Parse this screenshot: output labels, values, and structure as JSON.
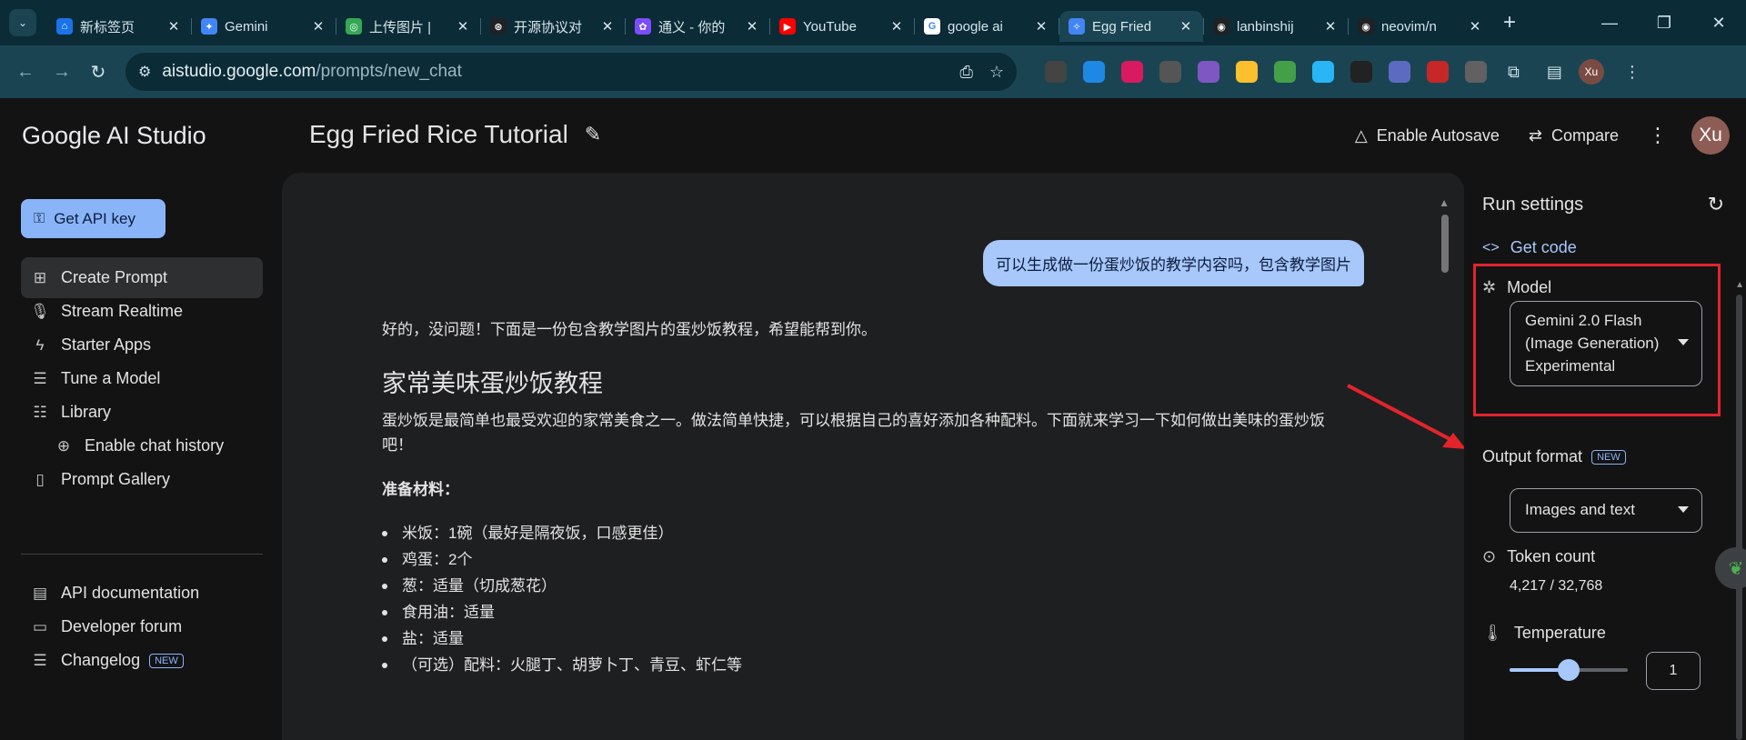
{
  "browser": {
    "tabs": [
      {
        "title": "新标签页",
        "color": "#1a73e8",
        "glyph": "⌂"
      },
      {
        "title": "Gemini",
        "color": "#4285f4",
        "glyph": "✦"
      },
      {
        "title": "上传图片 |",
        "color": "#34a853",
        "glyph": "◎"
      },
      {
        "title": "开源协议对",
        "color": "#202124",
        "glyph": "⊛"
      },
      {
        "title": "通义 - 你的",
        "color": "#7c4dff",
        "glyph": "✿"
      },
      {
        "title": "YouTube",
        "color": "#ff0000",
        "glyph": "▶"
      },
      {
        "title": "google ai",
        "color": "#ffffff",
        "glyph": "G"
      },
      {
        "title": "Egg Fried",
        "color": "#4285f4",
        "glyph": "✧"
      },
      {
        "title": "lanbinshij",
        "color": "#202124",
        "glyph": "◉"
      },
      {
        "title": "neovim/n",
        "color": "#202124",
        "glyph": "◉"
      }
    ],
    "active_tab": 7,
    "url_host": "aistudio.google.com",
    "url_path": "/prompts/new_chat",
    "profile_initials": "Xu",
    "extensions": [
      {
        "name": "owl-ext-icon",
        "color": "#444"
      },
      {
        "name": "globe-ext-icon",
        "color": "#1e88e5"
      },
      {
        "name": "translate-ext-icon",
        "color": "#d81b60"
      },
      {
        "name": "lens-ext-icon",
        "color": "#555"
      },
      {
        "name": "shield-ext-icon",
        "color": "#7e57c2"
      },
      {
        "name": "check-ext-icon",
        "color": "#fbc02d"
      },
      {
        "name": "leaf-ext-icon",
        "color": "#43a047"
      },
      {
        "name": "pen-ext-icon",
        "color": "#29b6f6"
      },
      {
        "name": "bili-ext-icon",
        "color": "#222"
      },
      {
        "name": "gem-ext-icon",
        "color": "#5c6bc0"
      },
      {
        "name": "target-ext-icon",
        "color": "#c62828"
      },
      {
        "name": "crx-ext-icon",
        "color": "#616161"
      }
    ]
  },
  "app": {
    "logo": "Google AI Studio",
    "api_key_label": "Get API key",
    "nav": [
      {
        "label": "Create Prompt",
        "icon": "create-prompt-icon",
        "glyph": "⊞",
        "active": true
      },
      {
        "label": "Stream Realtime",
        "icon": "mic-icon",
        "glyph": "🎙"
      },
      {
        "label": "Starter Apps",
        "icon": "bolt-icon",
        "glyph": "ϟ"
      },
      {
        "label": "Tune a Model",
        "icon": "tune-icon",
        "glyph": "☰"
      },
      {
        "label": "Library",
        "icon": "library-icon",
        "glyph": "☷"
      },
      {
        "label": "Enable chat history",
        "icon": "add-drive-icon",
        "glyph": "⊕",
        "indent": true
      },
      {
        "label": "Prompt Gallery",
        "icon": "gallery-icon",
        "glyph": "▯"
      }
    ],
    "nav2": [
      {
        "label": "API documentation",
        "icon": "docs-icon",
        "glyph": "▤"
      },
      {
        "label": "Developer forum",
        "icon": "forum-icon",
        "glyph": "▭"
      },
      {
        "label": "Changelog",
        "icon": "changelog-icon",
        "glyph": "☰",
        "badge": "NEW"
      }
    ],
    "title": "Egg Fried Rice Tutorial",
    "enable_autosave": "Enable Autosave",
    "compare": "Compare",
    "avatar": "Xu"
  },
  "chat": {
    "user_message": "可以生成做一份蛋炒饭的教学内容吗，包含教学图片",
    "reply_intro": "好的，没问题！下面是一份包含教学图片的蛋炒饭教程，希望能帮到你。",
    "reply_heading": "家常美味蛋炒饭教程",
    "reply_paragraph": "蛋炒饭是最简单也最受欢迎的家常美食之一。做法简单快捷，可以根据自己的喜好添加各种配料。下面就来学习一下如何做出美味的蛋炒饭吧！",
    "ingredients_title": "准备材料：",
    "ingredients": [
      "米饭：1碗（最好是隔夜饭，口感更佳）",
      "鸡蛋：2个",
      "葱：适量（切成葱花）",
      "食用油：适量",
      "盐：适量",
      "（可选）配料：火腿丁、胡萝卜丁、青豆、虾仁等"
    ]
  },
  "run_settings": {
    "title": "Run settings",
    "get_code": "Get code",
    "model_label": "Model",
    "model_value": [
      "Gemini 2.0 Flash",
      "(Image Generation)",
      "Experimental"
    ],
    "output_format_label": "Output format",
    "output_format_badge": "NEW",
    "output_format_value": "Images and text",
    "token_count_label": "Token count",
    "token_count_value": "4,217 / 32,768",
    "temperature_label": "Temperature",
    "temperature_value": "1",
    "temperature_level": 0.5
  },
  "colors": {
    "highlight": "#e3242b",
    "accent": "#a8c7fa"
  }
}
